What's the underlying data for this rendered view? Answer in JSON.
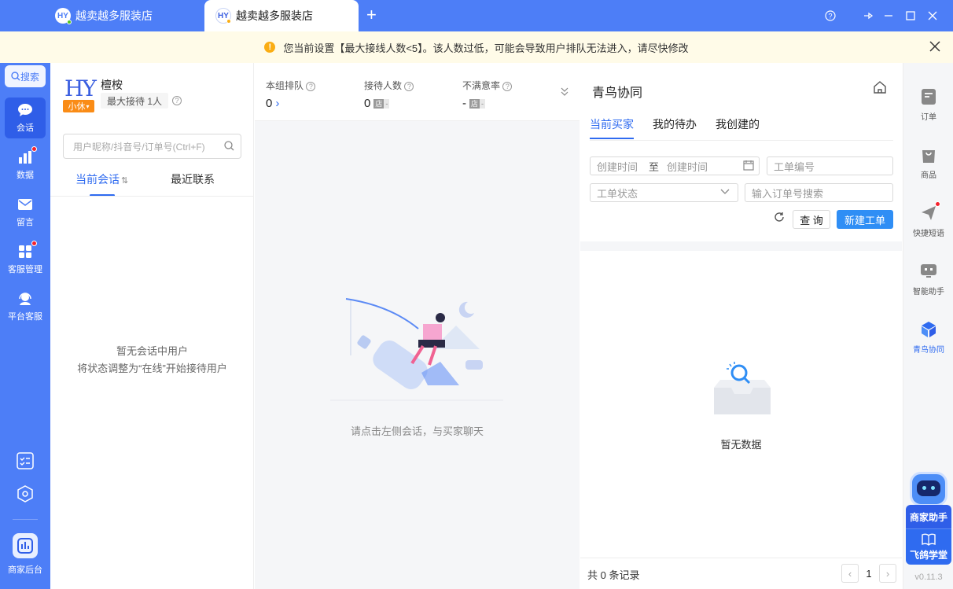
{
  "titlebar": {
    "tab1_label": "越卖越多服装店",
    "tab2_label": "越卖越多服装店",
    "logo_text": "HY",
    "add_tab": "+",
    "help": "?",
    "pin": "⊸",
    "minimize": "—",
    "maximize": "☐",
    "close": "✕"
  },
  "banner": {
    "message": "您当前设置【最大接线人数<5】。该人数过低，可能会导致用户排队无法进入，请尽快修改",
    "close": "✕"
  },
  "leftnav": {
    "search": "搜索",
    "items": [
      {
        "label": "会话",
        "icon": "chat-icon",
        "active": true
      },
      {
        "label": "数据",
        "icon": "bar-chart-icon",
        "dot": true
      },
      {
        "label": "留言",
        "icon": "mail-icon"
      },
      {
        "label": "客服管理",
        "icon": "grid-icon",
        "dot": true
      },
      {
        "label": "平台客服",
        "icon": "headset-icon"
      }
    ],
    "merchant_label": "商家后台"
  },
  "agent": {
    "logo_text": "HY",
    "status": "小休",
    "name": "檀桉",
    "max_receive": "最大接待 1人"
  },
  "sessions": {
    "search_placeholder": "用户昵称/抖音号/订单号(Ctrl+F)",
    "tab_current": "当前会话",
    "tab_recent": "最近联系",
    "empty_line1": "暂无会话中用户",
    "empty_line2": "将状态调整为“在线”开始接待用户"
  },
  "stats": {
    "queue_label": "本组排队",
    "queue_value": "0",
    "receive_label": "接待人数",
    "receive_value": "0",
    "unsatisfied_label": "不满意率",
    "unsatisfied_value": "-",
    "store_badge": "店",
    "dash": "-"
  },
  "chat": {
    "empty_text": "请点击左侧会话，与买家聊天"
  },
  "bird": {
    "title": "青鸟协同",
    "tabs": [
      "当前买家",
      "我的待办",
      "我创建的"
    ],
    "create_time_start": "创建时间",
    "to": "至",
    "create_time_end": "创建时间",
    "ticket_no": "工单编号",
    "ticket_status": "工单状态",
    "order_search": "输入订单号搜索",
    "query": "查 询",
    "new_ticket": "新建工单",
    "empty": "暂无数据",
    "total": "共 0 条记录",
    "page": "1"
  },
  "rightbar": {
    "items": [
      {
        "label": "订单",
        "icon": "order-icon"
      },
      {
        "label": "商品",
        "icon": "bag-icon"
      },
      {
        "label": "快捷短语",
        "icon": "send-icon",
        "dot": true
      },
      {
        "label": "智能助手",
        "icon": "robot-icon"
      },
      {
        "label": "青鸟协同",
        "icon": "cube-icon",
        "active": true
      }
    ],
    "assistant": "商家助手",
    "academy": "飞鸽学堂",
    "version": "v0.11.3"
  }
}
